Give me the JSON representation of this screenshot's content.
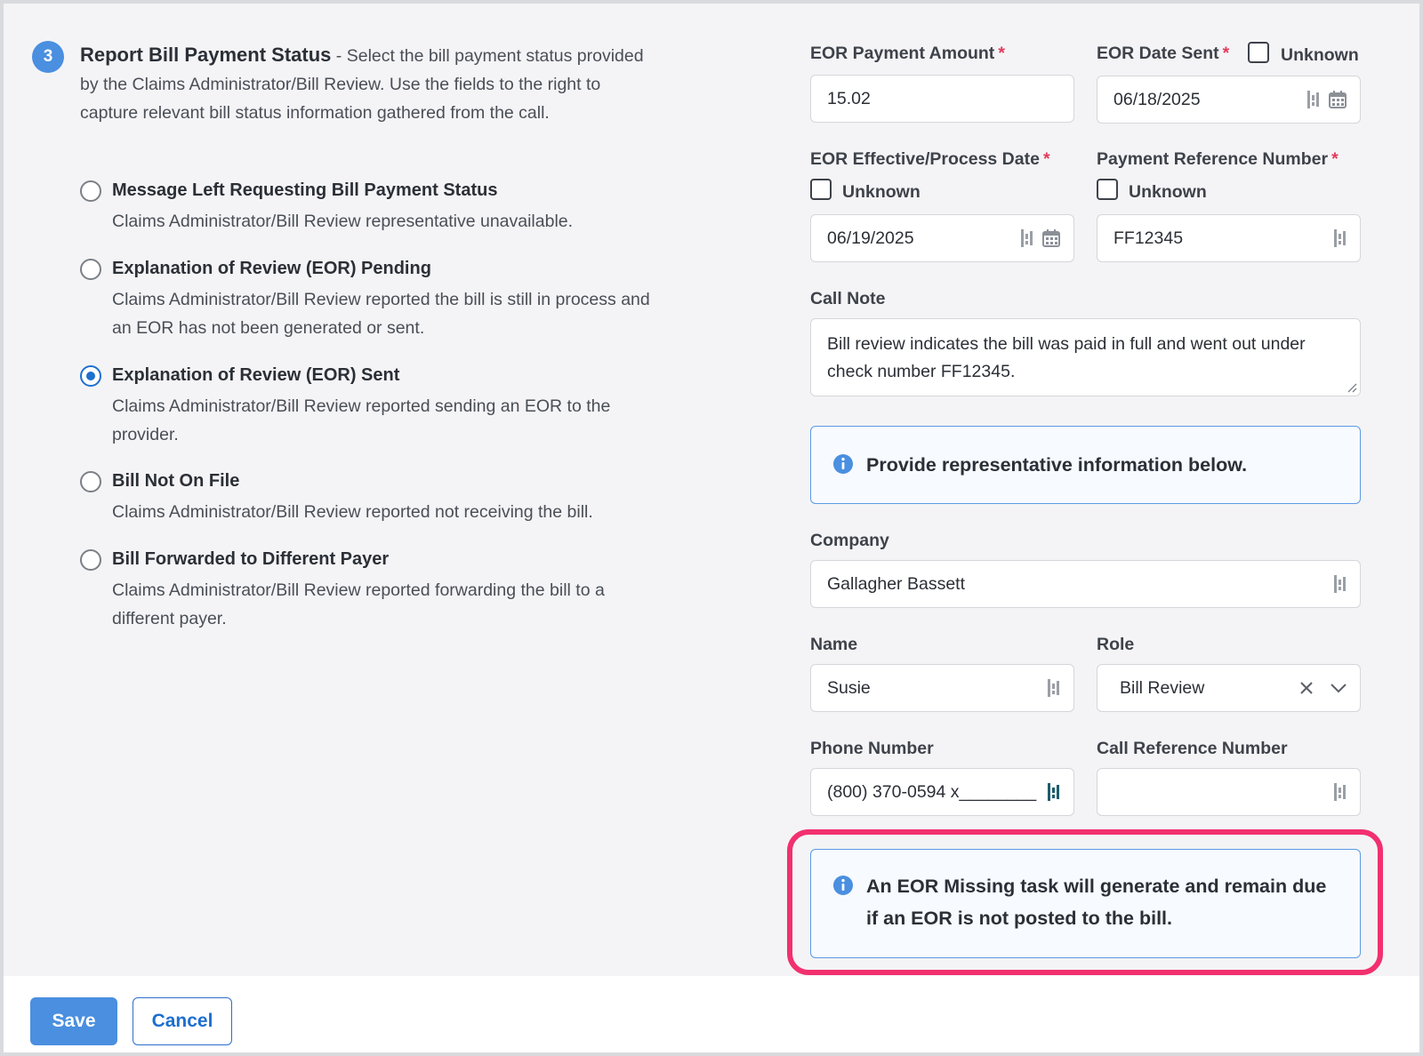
{
  "section": {
    "step_number": "3",
    "title": "Report Bill Payment Status",
    "description": " - Select the bill payment status provided by the Claims Administrator/Bill Review. Use the fields to the right to capture relevant bill status information gathered from the call."
  },
  "status_options": [
    {
      "label": "Message Left Requesting Bill Payment Status",
      "description": "Claims Administrator/Bill Review representative unavailable.",
      "selected": false
    },
    {
      "label": "Explanation of Review (EOR) Pending",
      "description": "Claims Administrator/Bill Review reported the bill is still in process and an EOR has not been generated or sent.",
      "selected": false
    },
    {
      "label": "Explanation of Review (EOR) Sent",
      "description": "Claims Administrator/Bill Review reported sending an EOR to the provider.",
      "selected": true
    },
    {
      "label": "Bill Not On File",
      "description": "Claims Administrator/Bill Review reported not receiving the bill.",
      "selected": false
    },
    {
      "label": "Bill Forwarded to Different Payer",
      "description": "Claims Administrator/Bill Review reported forwarding the bill to a different payer.",
      "selected": false
    }
  ],
  "fields": {
    "eor_payment_amount": {
      "label": "EOR Payment Amount",
      "required_mark": "*",
      "value": "15.02"
    },
    "eor_date_sent": {
      "label": "EOR Date Sent",
      "required_mark": "*",
      "unknown_label": "Unknown",
      "value": "06/18/2025"
    },
    "eor_effective_date": {
      "label": "EOR Effective/Process Date",
      "required_mark": "*",
      "unknown_label": "Unknown",
      "value": "06/19/2025"
    },
    "payment_reference_number": {
      "label": "Payment Reference Number",
      "required_mark": "*",
      "unknown_label": "Unknown",
      "value": "FF12345"
    },
    "call_note": {
      "label": "Call Note",
      "value": "Bill review indicates the bill was paid in full and went out under check number FF12345."
    },
    "company": {
      "label": "Company",
      "value": "Gallagher Bassett"
    },
    "name": {
      "label": "Name",
      "value": "Susie"
    },
    "role": {
      "label": "Role",
      "value": "Bill Review"
    },
    "phone_number": {
      "label": "Phone Number",
      "value": "(800) 370-0594 x________"
    },
    "call_reference_number": {
      "label": "Call Reference Number",
      "value": ""
    }
  },
  "info_messages": {
    "representative": "Provide representative information below.",
    "eor_missing": "An EOR Missing task will generate and remain due if an EOR is not posted to the bill."
  },
  "buttons": {
    "save": "Save",
    "cancel": "Cancel"
  },
  "colors": {
    "primary": "#4a8fe0",
    "link": "#1e6fcf",
    "required": "#e23a5b",
    "highlight": "#f2306f",
    "info_border": "#5b9ae6"
  }
}
